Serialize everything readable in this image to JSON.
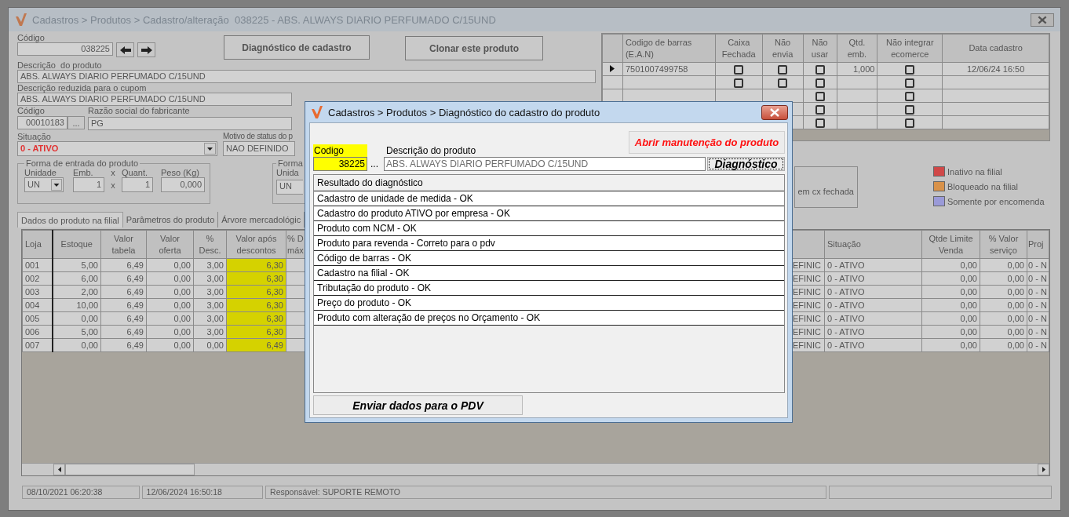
{
  "main_window": {
    "title": "Cadastros > Produtos > Cadastro/alteração  038225 - ABS. ALWAYS DIARIO PERFUMADO C/15UND",
    "form": {
      "codigo": {
        "label": "Código",
        "value": "038225"
      },
      "buttons": [
        "Diagnóstico de cadastro",
        "Clonar este produto"
      ],
      "descricao": {
        "label": "Descrição  do produto",
        "value": "ABS. ALWAYS DIARIO PERFUMADO C/15UND"
      },
      "descricao_reduzida": {
        "label": "Descrição reduzida para o cupom",
        "value": "ABS. ALWAYS DIARIO PERFUMADO C/15UND"
      },
      "fabricante_codigo": {
        "label": "Código",
        "value": "00010183",
        "button": "..."
      },
      "razao_social": {
        "label": "Razão social do fabricante",
        "value": "PG"
      },
      "situacao": {
        "label": "Situação",
        "value": "0 - ATIVO"
      },
      "motivo_status": {
        "label": "Motivo de status do p",
        "value": "NAO DEFINIDO"
      },
      "forma_entrada": {
        "title": "Forma de entrada do produto",
        "unidade": {
          "label": "Unidade",
          "value": "UN"
        },
        "emb": {
          "label": "Emb.",
          "value": "1"
        },
        "quant": {
          "label": "Quant.",
          "value": "1"
        },
        "peso": {
          "label": "Peso (Kg)",
          "value": "0,000"
        },
        "multiply_signs": [
          "x",
          "x"
        ]
      },
      "forma_2": {
        "title": "Forma",
        "unidade_label": "Unida",
        "unidade_value": "UN"
      }
    },
    "tabs": [
      {
        "label": "Dados do produto na filial",
        "selected": true
      },
      {
        "label": "Parâmetros do produto",
        "selected": false
      },
      {
        "label": "Árvore mercadológic",
        "selected": false
      }
    ],
    "barcode_table": {
      "columns": [
        "Codigo de barras (E.A.N)",
        "Caixa Fechada",
        "Não envia",
        "Não usar",
        "Qtd. emb.",
        "Não integrar ecomerce",
        "Data cadastro"
      ],
      "rows": [
        {
          "current": true,
          "ean": "7501007499758",
          "caixa_fechada": {
            "checked": false
          },
          "nao_envia": {
            "checked": false
          },
          "nao_usar": {
            "checked": false
          },
          "qtd_emb": "1,000",
          "nao_integrar": {
            "checked": false
          },
          "data": "12/06/24 16:50"
        },
        {
          "current": false,
          "caixa_fechada": {
            "checked": false
          },
          "nao_envia": {
            "checked": false
          },
          "nao_usar": {
            "checked": false
          },
          "nao_integrar": {
            "checked": false
          }
        },
        {
          "current": false,
          "nao_usar": {
            "checked": false
          },
          "nao_integrar": {
            "checked": false
          }
        },
        {
          "nao_usar": {
            "checked": false
          },
          "nao_integrar": {
            "checked": false
          }
        },
        {
          "nao_usar": {
            "checked": false
          },
          "nao_integrar": {
            "checked": false
          }
        }
      ]
    },
    "em_cx_fechada": "em cx fechada",
    "legend": [
      {
        "label": "Inativo na filial",
        "color": "#d04848"
      },
      {
        "label": "Bloqueado na filial",
        "color": "#d8924a"
      },
      {
        "label": "Somente por encomenda",
        "color": "#9a9ad8"
      }
    ],
    "stock_table": {
      "columns": [
        {
          "label": "Loja",
          "highlight": false
        },
        {
          "label": "Estoque",
          "highlight": false
        },
        {
          "label": "Valor tabela",
          "highlight": false
        },
        {
          "label": "Valor oferta",
          "highlight": false
        },
        {
          "label": "% Desc.",
          "highlight": false
        },
        {
          "label": "Valor após descontos",
          "highlight": true
        },
        {
          "label": "% D máx",
          "highlight": false
        }
      ],
      "rows": [
        [
          "001",
          "5,00",
          "6,49",
          "0,00",
          "3,00",
          "6,30"
        ],
        [
          "002",
          "6,00",
          "6,49",
          "0,00",
          "3,00",
          "6,30"
        ],
        [
          "003",
          "2,00",
          "6,49",
          "0,00",
          "3,00",
          "6,30"
        ],
        [
          "004",
          "10,00",
          "6,49",
          "0,00",
          "3,00",
          "6,30"
        ],
        [
          "005",
          "0,00",
          "6,49",
          "0,00",
          "3,00",
          "6,30"
        ],
        [
          "006",
          "5,00",
          "6,49",
          "0,00",
          "3,00",
          "6,30"
        ],
        [
          "007",
          "0,00",
          "6,49",
          "0,00",
          "0,00",
          "6,49"
        ]
      ]
    },
    "status_table": {
      "columns": [
        "",
        "Situação",
        "Qtde Limite Venda",
        "% Valor serviço",
        "Proj"
      ],
      "rows": [
        [
          "EFINIC",
          "0 - ATIVO",
          "0,00",
          "0,00",
          "0 - N"
        ],
        [
          "EFINIC",
          "0 - ATIVO",
          "0,00",
          "0,00",
          "0 - N"
        ],
        [
          "EFINIC",
          "0 - ATIVO",
          "0,00",
          "0,00",
          "0 - N"
        ],
        [
          "EFINIC",
          "0 - ATIVO",
          "0,00",
          "0,00",
          "0 - N"
        ],
        [
          "EFINIC",
          "0 - ATIVO",
          "0,00",
          "0,00",
          "0 - N"
        ],
        [
          "EFINIC",
          "0 - ATIVO",
          "0,00",
          "0,00",
          "0 - N"
        ],
        [
          "EFINIC",
          "0 - ATIVO",
          "0,00",
          "0,00",
          "0 - N"
        ]
      ]
    },
    "status_bar": [
      "08/10/2021 06:20:38",
      "12/06/2024 16:50:18",
      "Responsável: SUPORTE REMOTO"
    ]
  },
  "dialog": {
    "title": "Cadastros > Produtos > Diagnóstico do cadastro do produto",
    "open_button": "Abrir manutenção do produto",
    "codigo": {
      "label": "Codigo",
      "value": "38225",
      "highlight": true,
      "button": "..."
    },
    "descricao": {
      "label": "Descrição do produto",
      "value": "ABS. ALWAYS DIARIO PERFUMADO C/15UND"
    },
    "diagnose_button": {
      "label": "Diagnóstico",
      "focused": true
    },
    "results": {
      "header": "Resultado do diagnóstico",
      "rows": [
        "Cadastro de unidade de medida - OK",
        "Cadastro do produto ATIVO por empresa - OK",
        "Produto com NCM - OK",
        "Produto para revenda - Correto para o pdv",
        "Código de barras - OK",
        "Cadastro na filial - OK",
        "Tributação do produto - OK",
        "Preço do produto - OK",
        "Produto com alteração de preços no Orçamento - OK"
      ]
    },
    "send_button": "Enviar dados para o PDV"
  }
}
